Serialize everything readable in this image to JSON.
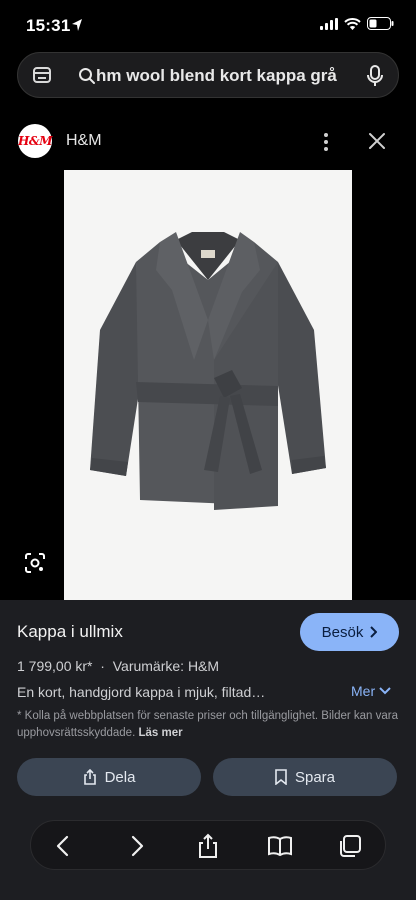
{
  "status": {
    "time": "15:31"
  },
  "search": {
    "query": "hm wool blend kort kappa grå"
  },
  "source": {
    "logo_text": "H&M",
    "name": "H&M"
  },
  "product": {
    "title": "Kappa i ullmix",
    "visit_label": "Besök",
    "price": "1 799,00 kr*",
    "separator": "·",
    "brand": "Varumärke: H&M",
    "description": "En kort, handgjord kappa i mjuk, filtad…",
    "more_label": "Mer",
    "disclaimer": "* Kolla på webbplatsen för senaste priser och tillgänglighet. Bilder kan vara upphovsrättsskyddade.",
    "learn_more": "Läs mer",
    "share_label": "Dela",
    "save_label": "Spara"
  },
  "colors": {
    "accent": "#8ab4f8",
    "panel": "#1d1e22",
    "button": "#3b4553"
  },
  "icons": [
    "location-arrow-icon",
    "signal-icon",
    "wifi-icon",
    "battery-icon",
    "google-lens-icon",
    "search-icon",
    "mic-icon",
    "kebab-icon",
    "close-icon",
    "chevron-right-icon",
    "chevron-down-icon",
    "share-icon",
    "bookmark-icon",
    "back-icon",
    "forward-icon",
    "book-icon",
    "tabs-icon"
  ]
}
